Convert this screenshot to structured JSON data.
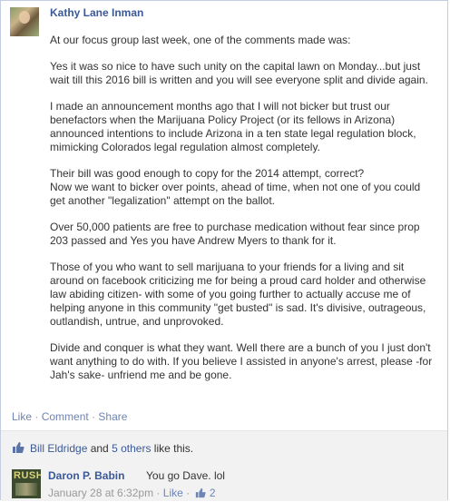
{
  "post": {
    "author": "Kathy Lane Inman",
    "paragraphs": [
      "At our focus group last week, one of the comments made was:",
      "Yes it was so nice to have such unity on the capital lawn on Monday...but just wait till this 2016 bill is written and you will see everyone split and divide again.",
      "I made an announcement months ago that I will not bicker but trust our benefactors when the Marijuana Policy Project (or its fellows in Arizona) announced intentions to include Arizona in a ten state legal regulation block, mimicking Colorados legal regulation almost completely.",
      "Their bill was good enough to copy for the 2014 attempt, correct?",
      "Now we want to bicker over points, ahead of time, when not one of you could get another \"legalization\" attempt on the ballot.",
      "Over 50,000 patients are free to purchase medication without fear since prop 203 passed and Yes you have Andrew Myers to thank for it.",
      "Those of you who want to sell marijuana to your friends for a living and sit around on facebook criticizing me for being a proud card holder and otherwise law abiding citizen- with some of you going further to actually accuse me of helping anyone in this community \"get busted\" is sad. It's divisive, outrageous, outlandish, untrue, and unprovoked.",
      "Divide and conquer is what they want. Well there are a bunch of you I just don't want anything to do with. If you believe I assisted in anyone's arrest, please -for Jah's sake- unfriend me and be gone."
    ]
  },
  "actions": {
    "like": "Like",
    "comment": "Comment",
    "share": "Share",
    "separator": "·"
  },
  "likes": {
    "first_name": "Bill Eldridge",
    "conjunction": " and ",
    "others": "5 others",
    "suffix": " like this."
  },
  "comment": {
    "author": "Daron P. Babin",
    "text": "You go Dave. lol",
    "timestamp": "January 28 at 6:32pm",
    "like_label": "Like",
    "like_count": "2",
    "avatar_text": "RUSH"
  },
  "colors": {
    "link": "#3b5998",
    "muted_link": "#6d84b4",
    "bar": "#f2f2f2"
  }
}
